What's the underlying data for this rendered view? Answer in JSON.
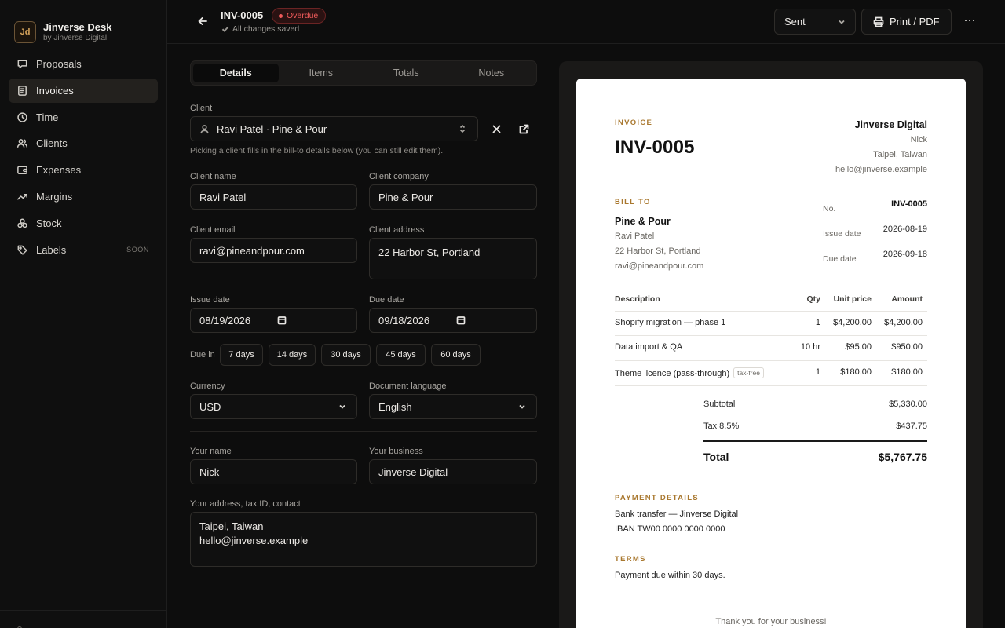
{
  "brand": {
    "logo": "Jd",
    "name": "Jinverse Desk",
    "subtitle": "by Jinverse Digital"
  },
  "sidebar": {
    "items": [
      {
        "label": "Proposals",
        "icon": "chat-bubble-icon",
        "active": false
      },
      {
        "label": "Invoices",
        "icon": "receipt-icon",
        "active": true
      },
      {
        "label": "Time",
        "icon": "clock-icon",
        "active": false
      },
      {
        "label": "Clients",
        "icon": "users-icon",
        "active": false
      },
      {
        "label": "Expenses",
        "icon": "wallet-icon",
        "active": false
      },
      {
        "label": "Margins",
        "icon": "trend-icon",
        "active": false
      },
      {
        "label": "Stock",
        "icon": "boxes-icon",
        "active": false
      },
      {
        "label": "Labels",
        "icon": "tag-icon",
        "active": false,
        "badge": "SOON"
      }
    ]
  },
  "header": {
    "doc_id": "INV-0005",
    "status_badge": "Overdue",
    "saved_text": "All changes saved",
    "status_select": "Sent",
    "print_label": "Print / PDF",
    "more_label": "···"
  },
  "form": {
    "tabs": [
      "Details",
      "Items",
      "Totals",
      "Notes"
    ],
    "active_tab": "Details",
    "client_label": "Client",
    "client_value": "Ravi Patel · Pine & Pour",
    "client_hint": "Picking a client fills in the bill-to details below (you can still edit them).",
    "client_name_label": "Client name",
    "client_name": "Ravi Patel",
    "client_company_label": "Client company",
    "client_company": "Pine & Pour",
    "client_email_label": "Client email",
    "client_email": "ravi@pineandpour.com",
    "client_address_label": "Client address",
    "client_address": "22 Harbor St, Portland",
    "issue_date_label": "Issue date",
    "issue_date": "08/19/2026",
    "due_date_label": "Due date",
    "due_date": "09/18/2026",
    "due_in_label": "Due in",
    "due_in_options": [
      "7 days",
      "14 days",
      "30 days",
      "45 days",
      "60 days"
    ],
    "currency_label": "Currency",
    "currency": "USD",
    "language_label": "Document language",
    "language": "English",
    "your_name_label": "Your name",
    "your_name": "Nick",
    "your_business_label": "Your business",
    "your_business": "Jinverse Digital",
    "your_address_label": "Your address, tax ID, contact",
    "your_address": "Taipei, Taiwan\nhello@jinverse.example"
  },
  "preview": {
    "eyebrow": "INVOICE",
    "title": "INV-0005",
    "from": {
      "business": "Jinverse Digital",
      "name": "Nick",
      "location": "Taipei, Taiwan",
      "email": "hello@jinverse.example"
    },
    "bill_to_label": "BILL TO",
    "bill_to": {
      "company": "Pine & Pour",
      "name": "Ravi Patel",
      "address": "22 Harbor St, Portland",
      "email": "ravi@pineandpour.com"
    },
    "meta": {
      "no_label": "No.",
      "no_value": "INV-0005",
      "issue_label": "Issue date",
      "issue_value": "2026-08-19",
      "due_label": "Due date",
      "due_value": "2026-09-18"
    },
    "table": {
      "headers": {
        "description": "Description",
        "qty": "Qty",
        "unit": "Unit price",
        "amount": "Amount"
      },
      "rows": [
        {
          "description": "Shopify migration — phase 1",
          "qty": "1",
          "unit": "$4,200.00",
          "amount": "$4,200.00",
          "tag": ""
        },
        {
          "description": "Data import & QA",
          "qty": "10 hr",
          "unit": "$95.00",
          "amount": "$950.00",
          "tag": ""
        },
        {
          "description": "Theme licence (pass-through)",
          "qty": "1",
          "unit": "$180.00",
          "amount": "$180.00",
          "tag": "tax-free"
        }
      ]
    },
    "totals": {
      "subtotal_label": "Subtotal",
      "subtotal": "$5,330.00",
      "tax_label": "Tax 8.5%",
      "tax": "$437.75",
      "total_label": "Total",
      "total": "$5,767.75"
    },
    "payment_label": "PAYMENT DETAILS",
    "payment_line1": "Bank transfer — Jinverse Digital",
    "payment_line2": "IBAN TW00 0000 0000 0000",
    "terms_label": "TERMS",
    "terms": "Payment due within 30 days.",
    "thanks": "Thank you for your business!"
  },
  "colors": {
    "background": "#0d0d0d",
    "accent_gold": "#a9782f",
    "overdue_red": "#ef5a5a",
    "paper": "#ffffff"
  }
}
